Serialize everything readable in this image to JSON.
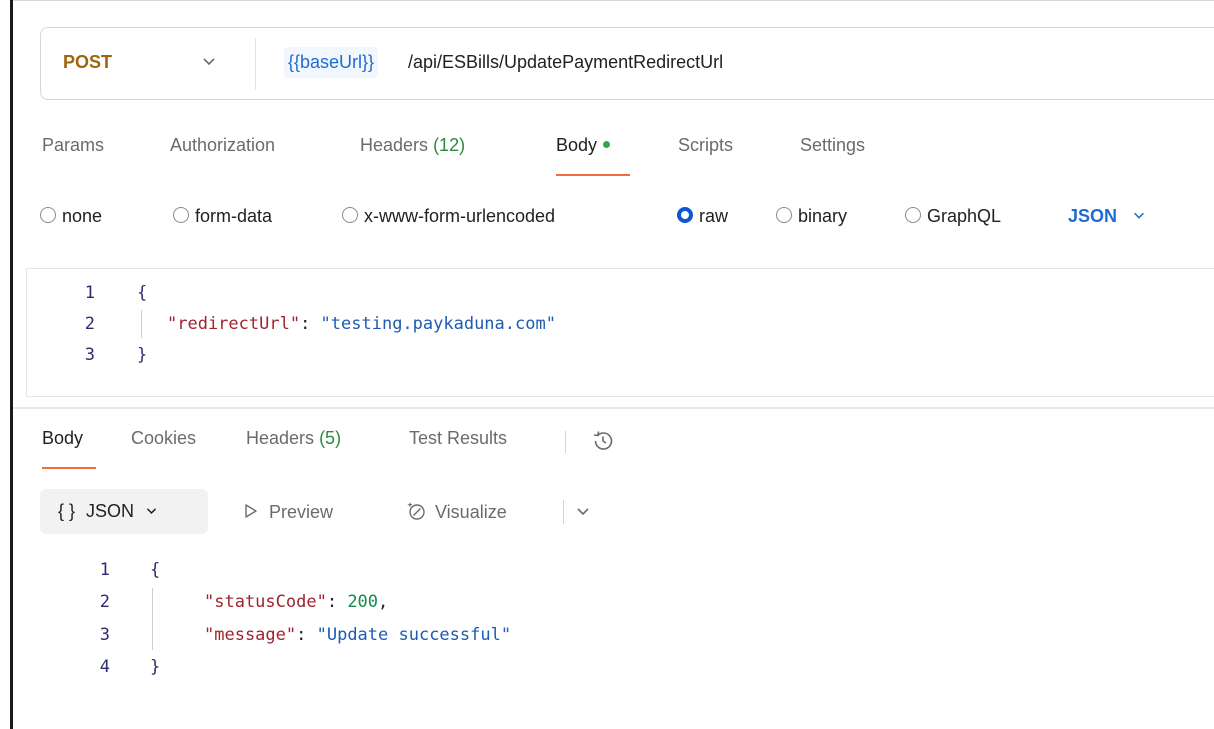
{
  "request": {
    "method": "POST",
    "url_variable": "{{baseUrl}}",
    "url_path": "/api/ESBills/UpdatePaymentRedirectUrl"
  },
  "request_tabs": {
    "params": "Params",
    "authorization": "Authorization",
    "headers_label": "Headers",
    "headers_count": "(12)",
    "body": "Body",
    "scripts": "Scripts",
    "settings": "Settings"
  },
  "body_types": {
    "none": "none",
    "form_data": "form-data",
    "urlencoded": "x-www-form-urlencoded",
    "raw": "raw",
    "binary": "binary",
    "graphql": "GraphQL",
    "selected": "raw",
    "language": "JSON"
  },
  "request_body": {
    "lines": [
      {
        "num": "1",
        "open": "{"
      },
      {
        "num": "2",
        "key": "\"redirectUrl\"",
        "colon": ": ",
        "value": "\"testing.paykaduna.com\""
      },
      {
        "num": "3",
        "close": "}"
      }
    ]
  },
  "response_tabs": {
    "body": "Body",
    "cookies": "Cookies",
    "headers_label": "Headers",
    "headers_count": "(5)",
    "test_results": "Test Results"
  },
  "response_toolbar": {
    "format_braces": "{ }",
    "format": "JSON",
    "preview": "Preview",
    "visualize": "Visualize"
  },
  "response_body": {
    "lines": [
      {
        "num": "1",
        "open": "{"
      },
      {
        "num": "2",
        "key": "\"statusCode\"",
        "colon": ": ",
        "value": "200",
        "trail": ","
      },
      {
        "num": "3",
        "key": "\"message\"",
        "colon": ": ",
        "value": "\"Update successful\""
      },
      {
        "num": "4",
        "close": "}"
      }
    ]
  },
  "colors": {
    "method": "#a0650c",
    "active_tab_underline": "#f26b3a",
    "count_green": "#2e8a3c",
    "link_blue": "#1f6bd1",
    "json_key": "#a0232e",
    "json_string": "#1d5bb5",
    "json_number": "#118a4d"
  },
  "icons": [
    "chevron-down-icon",
    "history-icon",
    "play-icon",
    "visualize-icon"
  ]
}
